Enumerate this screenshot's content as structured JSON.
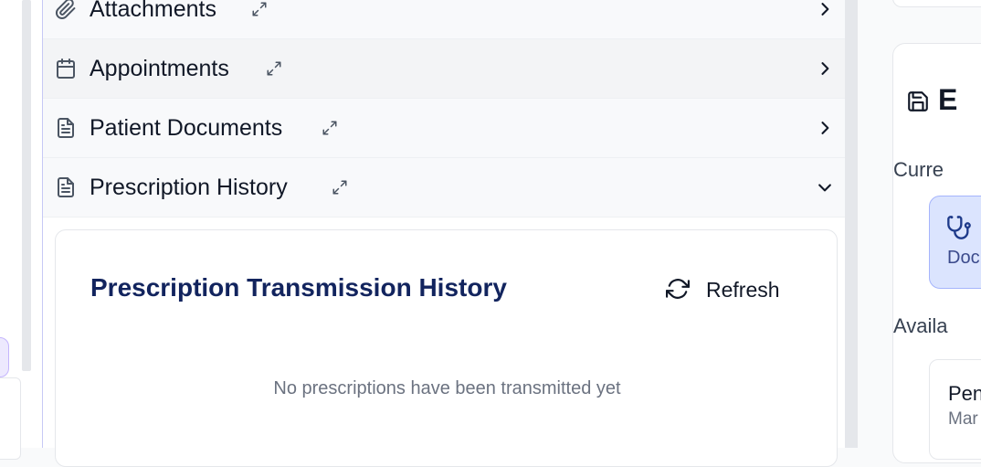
{
  "sections": [
    {
      "label": "Attachments",
      "icon": "paperclip-icon",
      "state": "collapsed"
    },
    {
      "label": "Appointments",
      "icon": "calendar-icon",
      "state": "collapsed"
    },
    {
      "label": "Patient Documents",
      "icon": "document-icon",
      "state": "collapsed"
    },
    {
      "label": "Prescription History",
      "icon": "document-icon",
      "state": "expanded"
    }
  ],
  "history": {
    "title": "Prescription Transmission History",
    "refresh_label": "Refresh",
    "empty_message": "No prescriptions have been transmitted yet"
  },
  "right_panel": {
    "heading": "E",
    "current_label": "Curre",
    "role_text": "Doc",
    "available_label": "Availa",
    "item_title": "Pen",
    "item_subtitle": "Mar"
  },
  "colors": {
    "title": "#12245e",
    "accent_border": "#c7c9f5",
    "role_card_bg": "#dbe4fe",
    "role_card_text": "#3b4a8c"
  }
}
